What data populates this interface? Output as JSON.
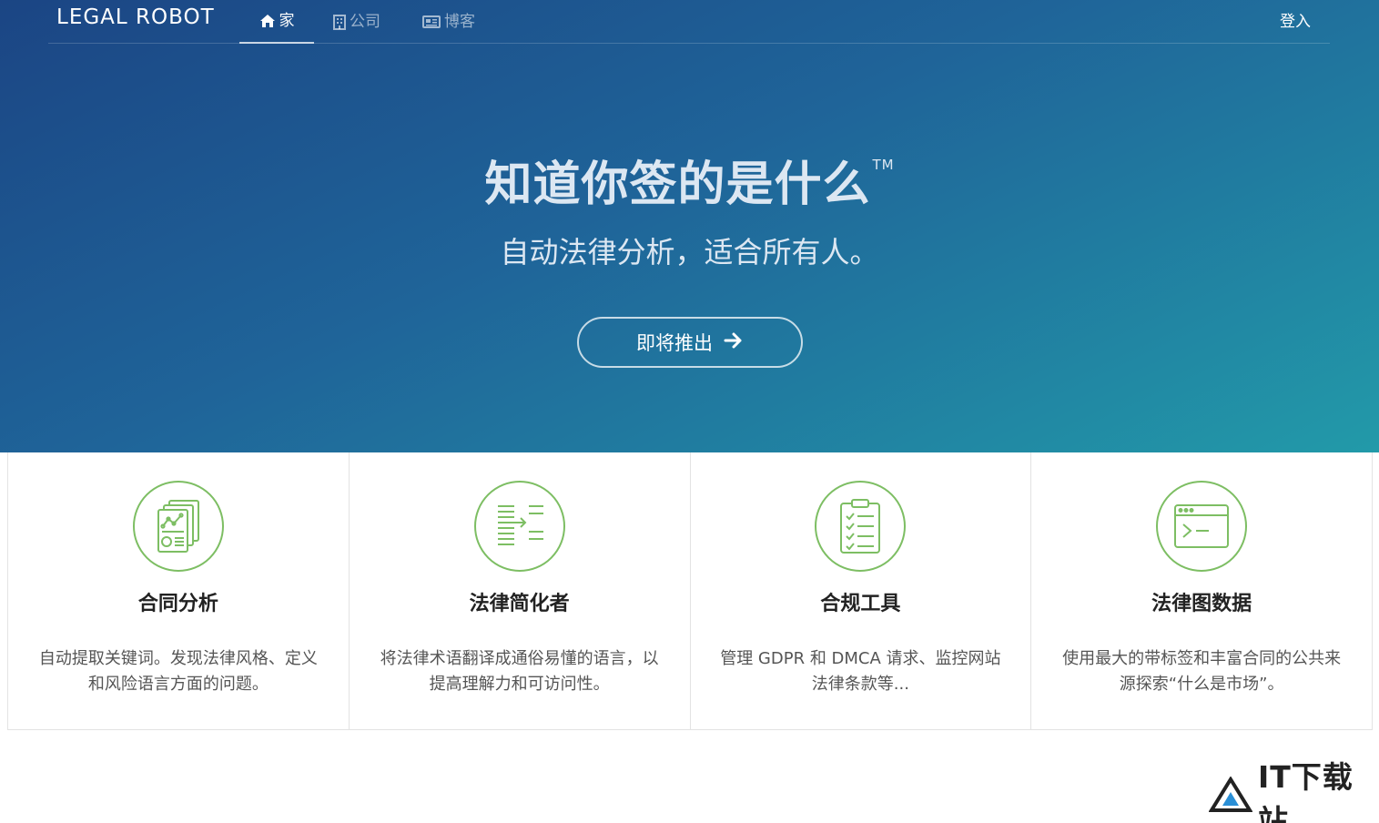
{
  "nav": {
    "logo": "LEGAL ROBOT",
    "items": [
      {
        "label": "家",
        "icon": "home-icon",
        "active": true
      },
      {
        "label": "公司",
        "icon": "building-icon",
        "active": false
      },
      {
        "label": "博客",
        "icon": "newspaper-icon",
        "active": false
      }
    ],
    "login": "登入"
  },
  "hero": {
    "title": "知道你签的是什么",
    "trademark": "TM",
    "subtitle": "自动法律分析，适合所有人。",
    "cta_label": "即将推出",
    "cta_icon": "arrow-right-icon"
  },
  "features": [
    {
      "icon": "contract-analysis-icon",
      "title": "合同分析",
      "desc": "自动提取关键词。发现法律风格、定义和风险语言方面的问题。"
    },
    {
      "icon": "simplifier-icon",
      "title": "法律简化者",
      "desc": "将法律术语翻译成通俗易懂的语言，以提高理解力和可访问性。"
    },
    {
      "icon": "checklist-icon",
      "title": "合规工具",
      "desc": "管理 GDPR 和 DMCA 请求、监控网站法律条款等..."
    },
    {
      "icon": "terminal-window-icon",
      "title": "法律图数据",
      "desc": "使用最大的带标签和丰富合同的公共来源探索“什么是市场”。"
    }
  ],
  "watermark": {
    "text": "IT下载站",
    "icon": "triangle-logo-icon"
  },
  "colors": {
    "accent_green": "#7dbe63",
    "hero_start": "#1b4584",
    "hero_end": "#229aa9"
  }
}
